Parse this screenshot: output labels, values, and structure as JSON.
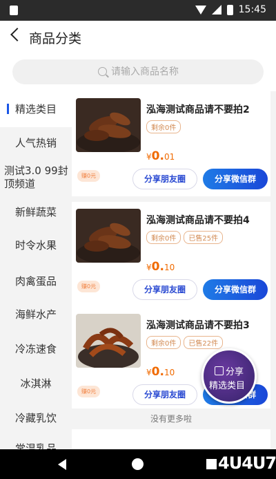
{
  "status_bar": {
    "time": "15:45"
  },
  "header": {
    "title": "商品分类"
  },
  "search": {
    "placeholder": "请输入商品名称"
  },
  "sidebar": {
    "items": [
      {
        "label": "精选类目",
        "active": true
      },
      {
        "label": "人气热销"
      },
      {
        "label": "测试3.0 99封顶频道"
      },
      {
        "label": "新鲜蔬菜"
      },
      {
        "label": "时令水果"
      },
      {
        "label": "肉禽蛋品"
      },
      {
        "label": "海鲜水产"
      },
      {
        "label": "冷冻速食"
      },
      {
        "label": "冰淇淋"
      },
      {
        "label": "冷藏乳饮"
      },
      {
        "label": "常温乳品"
      }
    ]
  },
  "products": [
    {
      "title": "泓海测试商品请不要拍2",
      "stock": "剩余0件",
      "sold": "",
      "currency": "¥",
      "price_int": "0.",
      "price_dec": "01",
      "earn": "赚0元",
      "share_moments": "分享朋友圈",
      "share_wechat": "分享微信群"
    },
    {
      "title": "泓海测试商品请不要拍4",
      "stock": "剩余0件",
      "sold": "已售25件",
      "currency": "¥",
      "price_int": "0.",
      "price_dec": "10",
      "earn": "赚0元",
      "share_moments": "分享朋友圈",
      "share_wechat": "分享微信群"
    },
    {
      "title": "泓海测试商品请不要拍3",
      "stock": "剩余0件",
      "sold": "已售22件",
      "currency": "¥",
      "price_int": "0.",
      "price_dec": "10",
      "earn": "赚0元",
      "share_moments": "分享朋友圈",
      "share_wechat": "分享微信群"
    }
  ],
  "footer": {
    "no_more": "没有更多啦"
  },
  "fab": {
    "line1": "分享",
    "line2": "精选类目"
  },
  "watermark": "4U4U7"
}
